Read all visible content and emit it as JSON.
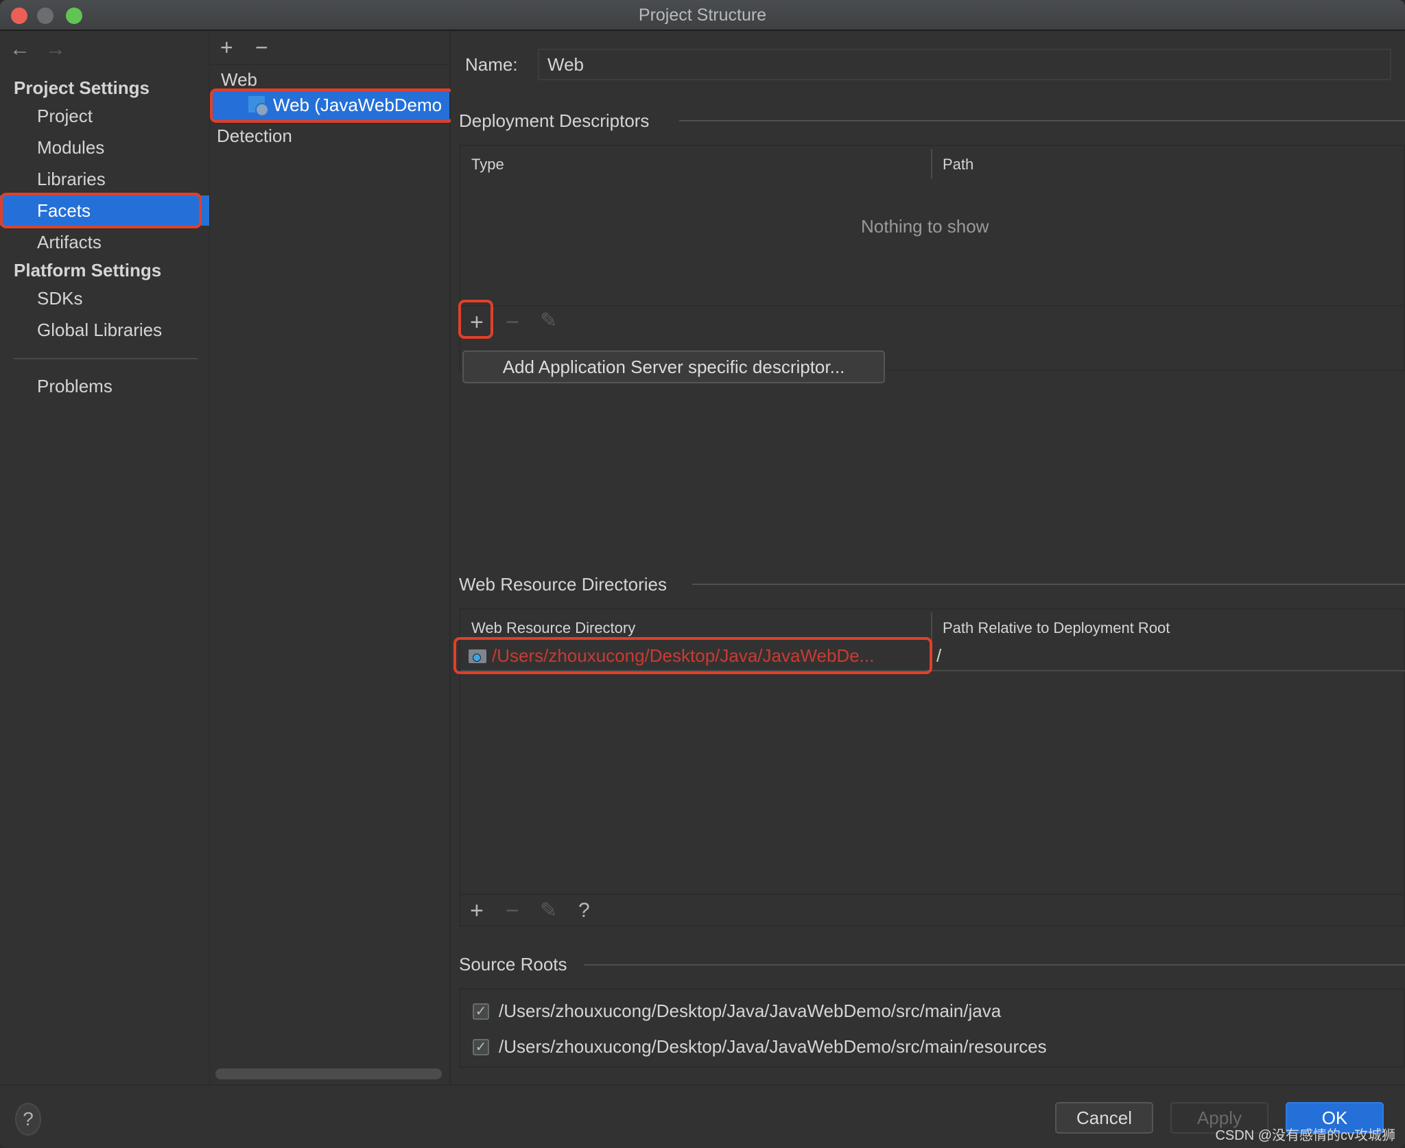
{
  "window": {
    "title": "Project Structure"
  },
  "nav": {
    "back_icon": "arrow-left-icon",
    "forward_icon": "arrow-right-icon",
    "groups": [
      {
        "label": "Project Settings",
        "items": [
          "Project",
          "Modules",
          "Libraries",
          "Facets",
          "Artifacts"
        ]
      },
      {
        "label": "Platform Settings",
        "items": [
          "SDKs",
          "Global Libraries"
        ]
      }
    ],
    "problems": "Problems",
    "selected": "Facets"
  },
  "middle": {
    "add": "+",
    "remove": "−",
    "tree_root": "Web",
    "tree_selected": "Web (JavaWebDemo",
    "detection": "Detection"
  },
  "content": {
    "name_label": "Name:",
    "name_value": "Web",
    "deployment": {
      "heading": "Deployment Descriptors",
      "columns": [
        "Type",
        "Path"
      ],
      "empty_text": "Nothing to show",
      "toolbar": {
        "add": "+",
        "remove": "−",
        "edit": "✎"
      },
      "add_server_button": "Add Application Server specific descriptor..."
    },
    "web_resources": {
      "heading": "Web Resource Directories",
      "columns": [
        "Web Resource Directory",
        "Path Relative to Deployment Root"
      ],
      "rows": [
        {
          "directory": "/Users/zhouxucong/Desktop/Java/JavaWebDe...",
          "relative": "/"
        }
      ],
      "toolbar": {
        "add": "+",
        "remove": "−",
        "edit": "✎",
        "help": "?"
      }
    },
    "source_roots": {
      "heading": "Source Roots",
      "items": [
        {
          "checked": true,
          "path": "/Users/zhouxucong/Desktop/Java/JavaWebDemo/src/main/java"
        },
        {
          "checked": true,
          "path": "/Users/zhouxucong/Desktop/Java/JavaWebDemo/src/main/resources"
        }
      ]
    }
  },
  "footer": {
    "help": "?",
    "cancel": "Cancel",
    "apply": "Apply",
    "ok": "OK"
  },
  "watermark": "CSDN @没有感情的cv攻城狮",
  "colors": {
    "accent": "#2470d8",
    "highlight_box": "#e0402a",
    "error_text": "#cc3a30",
    "background": "#323232"
  }
}
